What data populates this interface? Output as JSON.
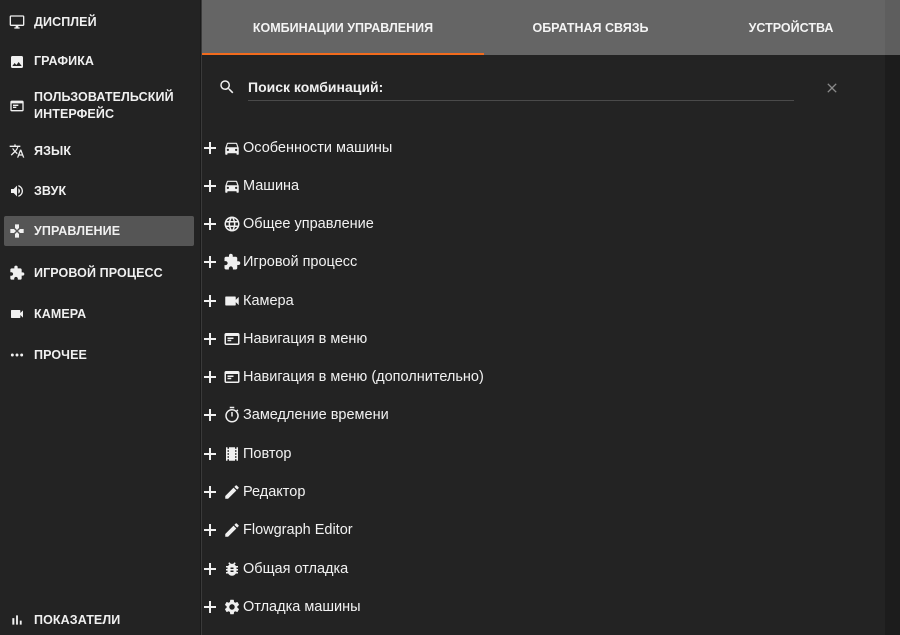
{
  "sidebar": {
    "items": [
      {
        "label": "Дисплей",
        "icon": "monitor-icon"
      },
      {
        "label": "Графика",
        "icon": "image-icon"
      },
      {
        "label": "Пользовательский интерфейс",
        "icon": "ui-window-icon"
      },
      {
        "label": "Язык",
        "icon": "translate-icon"
      },
      {
        "label": "Звук",
        "icon": "speaker-icon"
      },
      {
        "label": "Управление",
        "icon": "gamepad-icon",
        "active": true
      },
      {
        "label": "Игровой процесс",
        "icon": "puzzle-icon"
      },
      {
        "label": "Камера",
        "icon": "video-camera-icon"
      },
      {
        "label": "Прочее",
        "icon": "more-dots-icon"
      }
    ],
    "bottom_item": {
      "label": "Показатели",
      "icon": "bar-chart-icon"
    }
  },
  "tabs": [
    {
      "label": "Комбинации управления",
      "active": true
    },
    {
      "label": "Обратная связь",
      "active": false
    },
    {
      "label": "Устройства",
      "active": false
    }
  ],
  "search": {
    "placeholder": "Поиск комбинаций:",
    "value": ""
  },
  "categories": [
    {
      "label": "Особенности машины",
      "icon": "car-icon"
    },
    {
      "label": "Машина",
      "icon": "car-icon"
    },
    {
      "label": "Общее управление",
      "icon": "globe-icon"
    },
    {
      "label": "Игровой процесс",
      "icon": "puzzle-icon"
    },
    {
      "label": "Камера",
      "icon": "video-camera-icon"
    },
    {
      "label": "Навигация в меню",
      "icon": "menu-window-icon"
    },
    {
      "label": "Навигация в меню (дополнительно)",
      "icon": "menu-window-icon"
    },
    {
      "label": "Замедление времени",
      "icon": "stopwatch-icon"
    },
    {
      "label": "Повтор",
      "icon": "film-icon"
    },
    {
      "label": "Редактор",
      "icon": "pencil-icon"
    },
    {
      "label": "Flowgraph Editor",
      "icon": "pencil-icon"
    },
    {
      "label": "Общая отладка",
      "icon": "bug-icon"
    },
    {
      "label": "Отладка машины",
      "icon": "gear-icon"
    }
  ],
  "colors": {
    "accent": "#f26b1d",
    "background": "#232323",
    "tabbar": "#656565",
    "active_item": "#555555"
  }
}
